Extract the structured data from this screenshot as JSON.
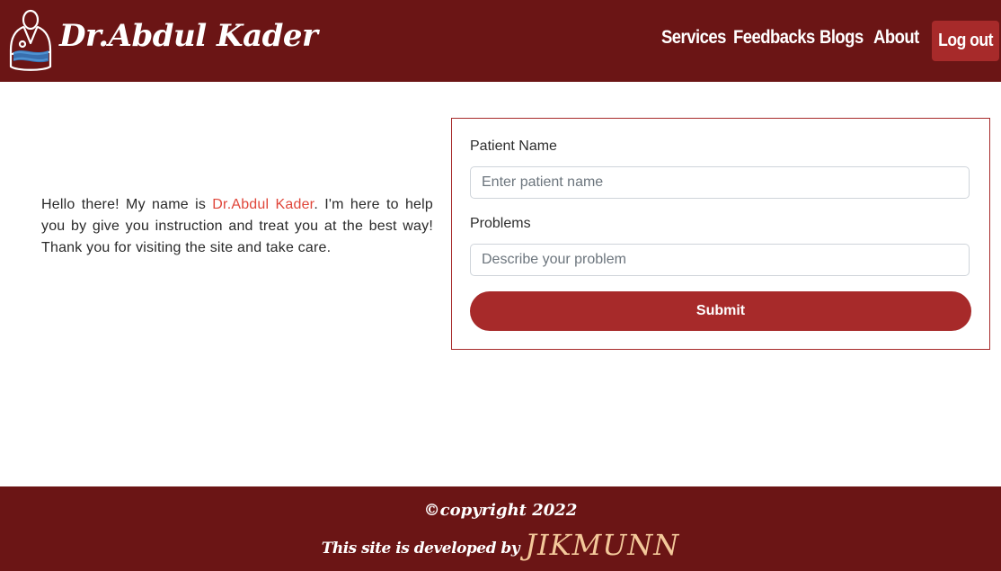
{
  "header": {
    "brand": "Dr.Abdul Kader",
    "nav": {
      "services": "Services",
      "feedbacks": "Feedbacks",
      "blogs": "Blogs",
      "about": "About"
    },
    "logout_label": "Log out",
    "logo_icon": "doctor-icon"
  },
  "intro": {
    "part1": "Hello there! My name is ",
    "name": "Dr.Abdul Kader",
    "part2": ". I'm here to help you by give you instruction and treat you at the best way! Thank you for visiting the site and take care."
  },
  "form": {
    "patient_name_label": "Patient Name",
    "patient_name_placeholder": "Enter patient name",
    "patient_name_value": "",
    "problems_label": "Problems",
    "problems_placeholder": "Describe your problem",
    "problems_value": "",
    "submit_label": "Submit"
  },
  "footer": {
    "copyright": "©copyright 2022",
    "developed_by": "This site is developed by",
    "developer": "JIKMUNN"
  },
  "colors": {
    "header_bg": "#6b1515",
    "accent": "#a72a2a",
    "highlight": "#e0463a",
    "developer_name": "#f3c89a"
  }
}
